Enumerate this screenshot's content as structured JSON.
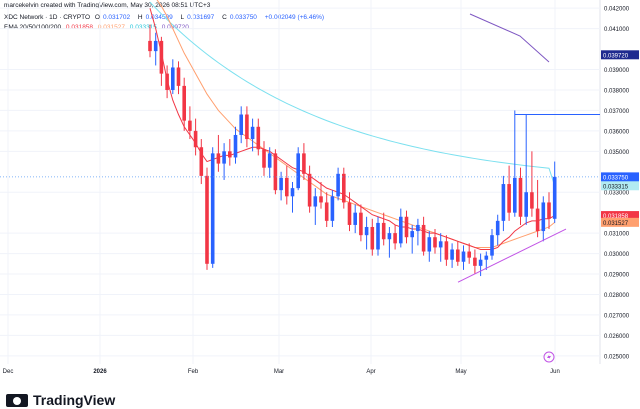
{
  "header": {
    "attribution": "marcekelvin created with TradingView.com, May 30, 2026 08:51 UTC+3",
    "symbol": "XDC Network · 1D · CRYPTO",
    "ohlc": {
      "o_label": "O",
      "o": "0.031702",
      "h_label": "H",
      "h": "0.034509",
      "l_label": "L",
      "l": "0.031697",
      "c_label": "C",
      "c": "0.033750",
      "change": "+0.002049 (+6.46%)"
    },
    "ema_label": "EMA 20/50/100/200",
    "ema_values": [
      "0.031858",
      "0.031527",
      "0.033315",
      "0.039720"
    ]
  },
  "footer": {
    "brand": "TradingView"
  },
  "colors": {
    "up": "#2962ff",
    "down": "#f23645",
    "ema20": "#f23645",
    "ema50": "#ff9f6e",
    "ema100": "#7be0ef",
    "ema200": "#7e57c2",
    "trendline": "#c254e6",
    "resistance": "#2962ff",
    "grid": "#f0f3fa",
    "price_line": "#5b9cf6"
  },
  "chart_data": {
    "type": "candlestick",
    "y_axis": {
      "ticks": [
        "0.042000",
        "0.041000",
        "0.039000",
        "0.038000",
        "0.037000",
        "0.036000",
        "0.035000",
        "0.033000",
        "0.031000",
        "0.030000",
        "0.029000",
        "0.028000",
        "0.027000",
        "0.026000",
        "0.025000"
      ],
      "range": [
        0.0246,
        0.0424
      ]
    },
    "x_axis": {
      "ticks": [
        "Dec",
        "2026",
        "Feb",
        "Mar",
        "Apr",
        "May",
        "Jun"
      ]
    },
    "price_labels": [
      {
        "value": 0.03972,
        "text": "0.039720",
        "bg": "#1e2a8f",
        "fg": "#ffffff"
      },
      {
        "value": 0.03375,
        "text": "0.033750",
        "bg": "#2962ff",
        "fg": "#ffffff"
      },
      {
        "value": 0.0334,
        "text": "18:08:51",
        "bg": "#2962ff",
        "fg": "#ffffff"
      },
      {
        "value": 0.033315,
        "text": "0.033315",
        "bg": "#b2ebf2",
        "fg": "#131722"
      },
      {
        "value": 0.031858,
        "text": "0.031858",
        "bg": "#f23645",
        "fg": "#ffffff"
      },
      {
        "value": 0.031527,
        "text": "0.031527",
        "bg": "#ff9f6e",
        "fg": "#131722"
      }
    ],
    "candles": [
      [
        0.0404,
        0.0412,
        0.0396,
        0.0399
      ],
      [
        0.0399,
        0.0408,
        0.0392,
        0.0404
      ],
      [
        0.0404,
        0.0406,
        0.0382,
        0.0388
      ],
      [
        0.0388,
        0.0392,
        0.0376,
        0.038
      ],
      [
        0.038,
        0.0395,
        0.0378,
        0.0391
      ],
      [
        0.0391,
        0.0394,
        0.0378,
        0.0382
      ],
      [
        0.0382,
        0.0386,
        0.036,
        0.0365
      ],
      [
        0.0365,
        0.0372,
        0.0356,
        0.036
      ],
      [
        0.036,
        0.0366,
        0.0348,
        0.0352
      ],
      [
        0.0352,
        0.0356,
        0.0334,
        0.0338
      ],
      [
        0.0338,
        0.0342,
        0.0292,
        0.0295
      ],
      [
        0.0295,
        0.0352,
        0.0293,
        0.0349
      ],
      [
        0.0349,
        0.0358,
        0.034,
        0.0344
      ],
      [
        0.0344,
        0.0354,
        0.0336,
        0.035
      ],
      [
        0.035,
        0.0356,
        0.0343,
        0.0347
      ],
      [
        0.0347,
        0.0362,
        0.0344,
        0.0358
      ],
      [
        0.0358,
        0.0372,
        0.0354,
        0.0368
      ],
      [
        0.0368,
        0.0372,
        0.0352,
        0.0356
      ],
      [
        0.0356,
        0.0366,
        0.035,
        0.0362
      ],
      [
        0.0362,
        0.0366,
        0.0348,
        0.0351
      ],
      [
        0.0351,
        0.0355,
        0.0338,
        0.0342
      ],
      [
        0.0342,
        0.0352,
        0.0337,
        0.0349
      ],
      [
        0.0349,
        0.0351,
        0.0329,
        0.0331
      ],
      [
        0.0331,
        0.034,
        0.0326,
        0.0337
      ],
      [
        0.0337,
        0.0343,
        0.0324,
        0.0328
      ],
      [
        0.0328,
        0.0335,
        0.032,
        0.0332
      ],
      [
        0.0332,
        0.0352,
        0.0331,
        0.0349
      ],
      [
        0.0349,
        0.0354,
        0.0336,
        0.0339
      ],
      [
        0.0339,
        0.0343,
        0.032,
        0.0323
      ],
      [
        0.0323,
        0.0332,
        0.0314,
        0.0328
      ],
      [
        0.0328,
        0.0335,
        0.0322,
        0.0325
      ],
      [
        0.0325,
        0.033,
        0.0313,
        0.0316
      ],
      [
        0.0316,
        0.0331,
        0.0313,
        0.0328
      ],
      [
        0.0328,
        0.0342,
        0.0326,
        0.0339
      ],
      [
        0.0339,
        0.0342,
        0.0322,
        0.0325
      ],
      [
        0.0325,
        0.033,
        0.0311,
        0.0314
      ],
      [
        0.0314,
        0.0324,
        0.031,
        0.032
      ],
      [
        0.032,
        0.0324,
        0.0306,
        0.0309
      ],
      [
        0.0309,
        0.0318,
        0.0302,
        0.0313
      ],
      [
        0.0313,
        0.0317,
        0.0299,
        0.0302
      ],
      [
        0.0302,
        0.0318,
        0.0299,
        0.0315
      ],
      [
        0.0315,
        0.032,
        0.0304,
        0.0307
      ],
      [
        0.0307,
        0.0313,
        0.0298,
        0.031
      ],
      [
        0.031,
        0.0314,
        0.0302,
        0.0305
      ],
      [
        0.0305,
        0.0322,
        0.0303,
        0.0318
      ],
      [
        0.0318,
        0.0321,
        0.0305,
        0.0308
      ],
      [
        0.0308,
        0.0314,
        0.03,
        0.0311
      ],
      [
        0.0311,
        0.0317,
        0.0304,
        0.0314
      ],
      [
        0.0314,
        0.0318,
        0.0299,
        0.0301
      ],
      [
        0.0301,
        0.0311,
        0.0296,
        0.0308
      ],
      [
        0.0308,
        0.0312,
        0.03,
        0.0303
      ],
      [
        0.0303,
        0.031,
        0.0296,
        0.0306
      ],
      [
        0.0306,
        0.0309,
        0.0294,
        0.0297
      ],
      [
        0.0297,
        0.0305,
        0.0293,
        0.0302
      ],
      [
        0.0302,
        0.0306,
        0.0294,
        0.0296
      ],
      [
        0.0296,
        0.0304,
        0.0292,
        0.0301
      ],
      [
        0.0301,
        0.0305,
        0.0295,
        0.0298
      ],
      [
        0.0298,
        0.0302,
        0.029,
        0.0294
      ],
      [
        0.0294,
        0.03,
        0.0289,
        0.0297
      ],
      [
        0.0297,
        0.0301,
        0.0292,
        0.0299
      ],
      [
        0.0299,
        0.0312,
        0.0297,
        0.0309
      ],
      [
        0.0309,
        0.0319,
        0.0304,
        0.0316
      ],
      [
        0.0316,
        0.0338,
        0.0311,
        0.0334
      ],
      [
        0.0334,
        0.0343,
        0.0316,
        0.032
      ],
      [
        0.032,
        0.037,
        0.0318,
        0.0337
      ],
      [
        0.0337,
        0.0342,
        0.0314,
        0.0318
      ],
      [
        0.0318,
        0.0368,
        0.0314,
        0.033
      ],
      [
        0.033,
        0.035,
        0.0318,
        0.0322
      ],
      [
        0.0322,
        0.0336,
        0.0308,
        0.0311
      ],
      [
        0.0311,
        0.0328,
        0.0306,
        0.0325
      ],
      [
        0.0325,
        0.033,
        0.0312,
        0.0317
      ],
      [
        0.0317,
        0.0345,
        0.0315,
        0.03375
      ]
    ],
    "ema20": [
      0.042,
      0.041,
      0.0398,
      0.0385,
      0.0375,
      0.0368,
      0.0362,
      0.0358,
      0.0354,
      0.0349,
      0.0345,
      0.0346,
      0.0347,
      0.0348,
      0.0348,
      0.0349,
      0.035,
      0.0351,
      0.0352,
      0.0352,
      0.0351,
      0.035,
      0.0348,
      0.0346,
      0.0344,
      0.0342,
      0.0341,
      0.034,
      0.0338,
      0.0336,
      0.0334,
      0.0332,
      0.0331,
      0.033,
      0.0329,
      0.0327,
      0.0325,
      0.0323,
      0.0321,
      0.0319,
      0.0318,
      0.0317,
      0.0316,
      0.0314,
      0.0313,
      0.0313,
      0.0312,
      0.0312,
      0.0311,
      0.031,
      0.031,
      0.0309,
      0.0308,
      0.0307,
      0.0306,
      0.0305,
      0.0304,
      0.0303,
      0.0302,
      0.0302,
      0.0302,
      0.0303,
      0.0306,
      0.0308,
      0.0311,
      0.0313,
      0.0315,
      0.0316,
      0.0316,
      0.0317,
      0.0317,
      0.031858
    ],
    "ema50": [
      0.0428,
      0.0425,
      0.0421,
      0.0416,
      0.041,
      0.0404,
      0.0398,
      0.0393,
      0.0388,
      0.0383,
      0.0378,
      0.0374,
      0.037,
      0.0367,
      0.0364,
      0.0361,
      0.0359,
      0.0357,
      0.0355,
      0.0353,
      0.0351,
      0.0349,
      0.0347,
      0.0345,
      0.0343,
      0.0341,
      0.0339,
      0.0337,
      0.0335,
      0.0333,
      0.0331,
      0.0329,
      0.0328,
      0.0327,
      0.0326,
      0.0325,
      0.0324,
      0.0323,
      0.0322,
      0.0321,
      0.032,
      0.0319,
      0.0318,
      0.0317,
      0.0316,
      0.0315,
      0.0314,
      0.0313,
      0.0312,
      0.0311,
      0.031,
      0.0309,
      0.0308,
      0.0307,
      0.0306,
      0.0305,
      0.0304,
      0.0303,
      0.0303,
      0.0303,
      0.0303,
      0.0304,
      0.0305,
      0.0306,
      0.0307,
      0.0308,
      0.0309,
      0.031,
      0.0311,
      0.0312,
      0.0313,
      0.031527
    ]
  }
}
